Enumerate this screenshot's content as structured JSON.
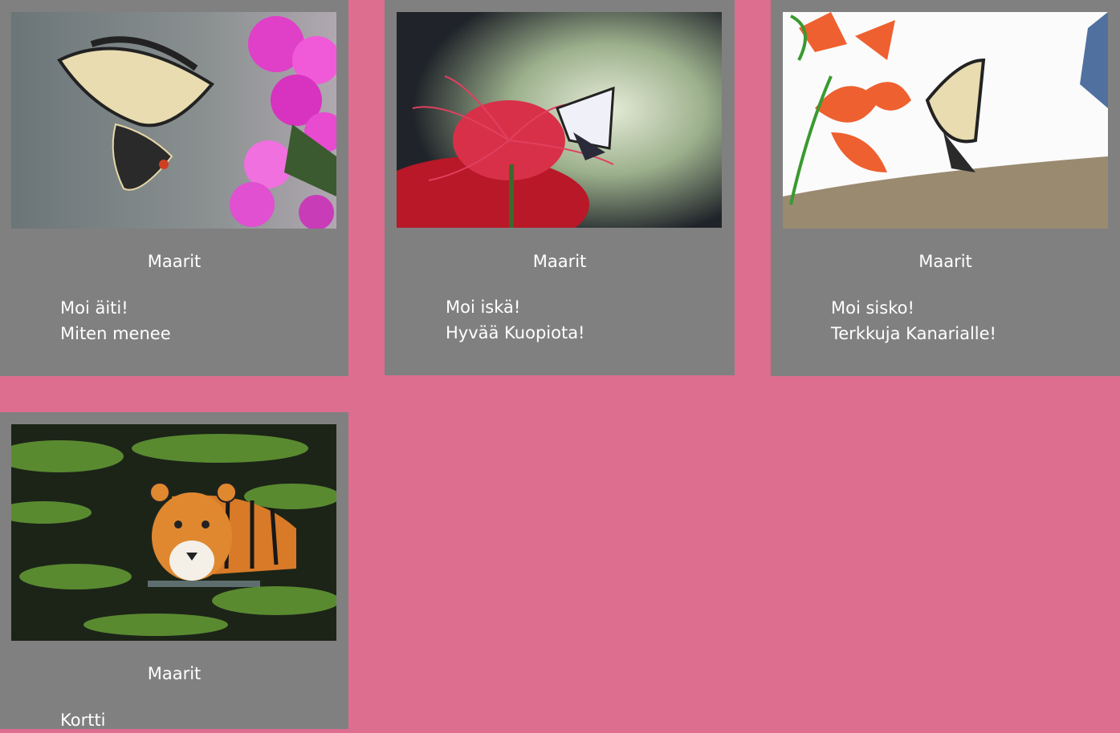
{
  "cards": [
    {
      "image": "swallowtail-butterfly-pink-flowers",
      "sender": "Maarit",
      "message": [
        "Moi äiti!",
        "Miten menee"
      ]
    },
    {
      "image": "butterfly-red-spider-lily",
      "sender": "Maarit",
      "message": [
        "Moi iskä!",
        "Hyvää Kuopiota!"
      ]
    },
    {
      "image": "swallowtail-butterfly-orange-lily",
      "sender": "Maarit",
      "message": [
        "Moi sisko!",
        "Terkkuja Kanarialle!"
      ]
    },
    {
      "image": "tiger-swimming-in-water",
      "sender": "Maarit",
      "message": [
        "Kortti"
      ]
    }
  ],
  "colors": {
    "page_background": "#dd6e8f",
    "card_background": "#808080",
    "text": "#ffffff"
  }
}
